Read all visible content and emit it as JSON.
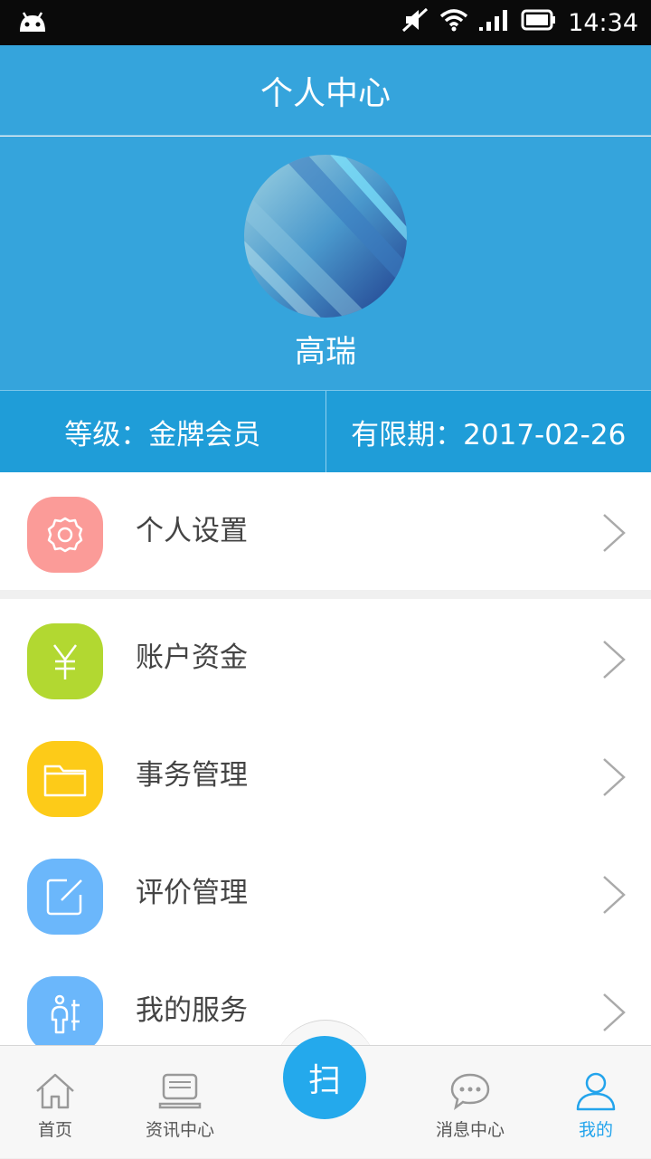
{
  "status_bar": {
    "time": "14:34"
  },
  "header": {
    "title": "个人中心"
  },
  "profile": {
    "name": "高瑞"
  },
  "info": {
    "level": "等级：金牌会员",
    "expiry": "有限期：2017-02-26"
  },
  "menu": [
    {
      "label": "个人设置",
      "icon": "gear-icon",
      "color": "#fb9b98"
    },
    {
      "label": "账户资金",
      "icon": "yen-icon",
      "color": "#b2d831"
    },
    {
      "label": "事务管理",
      "icon": "folder-icon",
      "color": "#fdcb18"
    },
    {
      "label": "评价管理",
      "icon": "edit-icon",
      "color": "#6bb7fb"
    },
    {
      "label": "我的服务",
      "icon": "service-icon",
      "color": "#6bb7fb"
    }
  ],
  "bottom_nav": {
    "home": "首页",
    "news": "资讯中心",
    "scan": "扫",
    "messages": "消息中心",
    "mine": "我的",
    "active_color": "#23a4ec"
  }
}
